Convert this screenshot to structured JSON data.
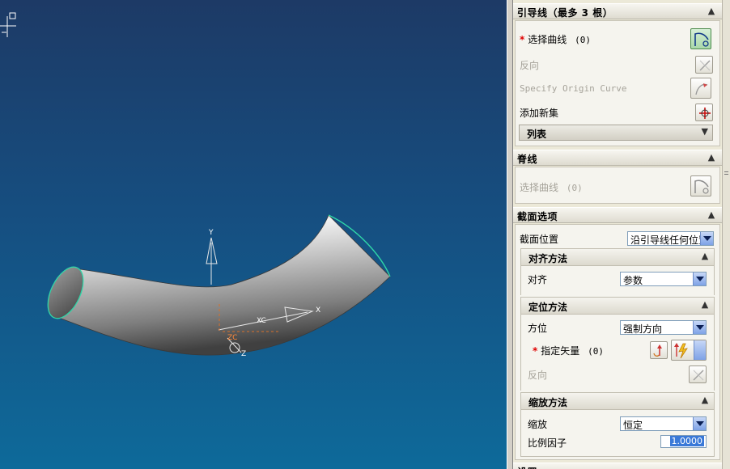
{
  "viewport": {
    "triad": {
      "y_label": "Y",
      "x_label": "X",
      "xc_label": "XC",
      "zc_label": "ZC",
      "z_label": "Z"
    }
  },
  "panel": {
    "guide": {
      "title": "引导线（最多 3 根）",
      "select_curve": {
        "required_mark": "*",
        "label": "选择曲线",
        "count": "(0)"
      },
      "reverse": "反向",
      "specify_origin": "Specify Origin Curve",
      "add_new_set": "添加新集",
      "list": "列表"
    },
    "spine": {
      "title": "脊线",
      "select_curve": "选择曲线",
      "count": "(0)"
    },
    "section_options": {
      "title": "截面选项",
      "position_label": "截面位置",
      "position_value": "沿引导线任何位置",
      "alignment": {
        "title": "对齐方法",
        "label": "对齐",
        "value": "参数"
      },
      "orientation": {
        "title": "定位方法",
        "label": "方位",
        "value": "强制方向",
        "vector": {
          "required_mark": "*",
          "label": "指定矢量",
          "count": "(0)"
        },
        "reverse": "反向"
      },
      "scaling": {
        "title": "缩放方法",
        "label": "缩放",
        "value": "恒定",
        "factor_label": "比例因子",
        "factor_value": "1.0000"
      }
    },
    "settings": {
      "title": "设置"
    }
  },
  "colors": {
    "viewport_top": "#1d3a66",
    "viewport_bottom": "#0e6a9a",
    "edge_highlight": "#2fd7a8",
    "accent_selected": "#3a79d8"
  }
}
